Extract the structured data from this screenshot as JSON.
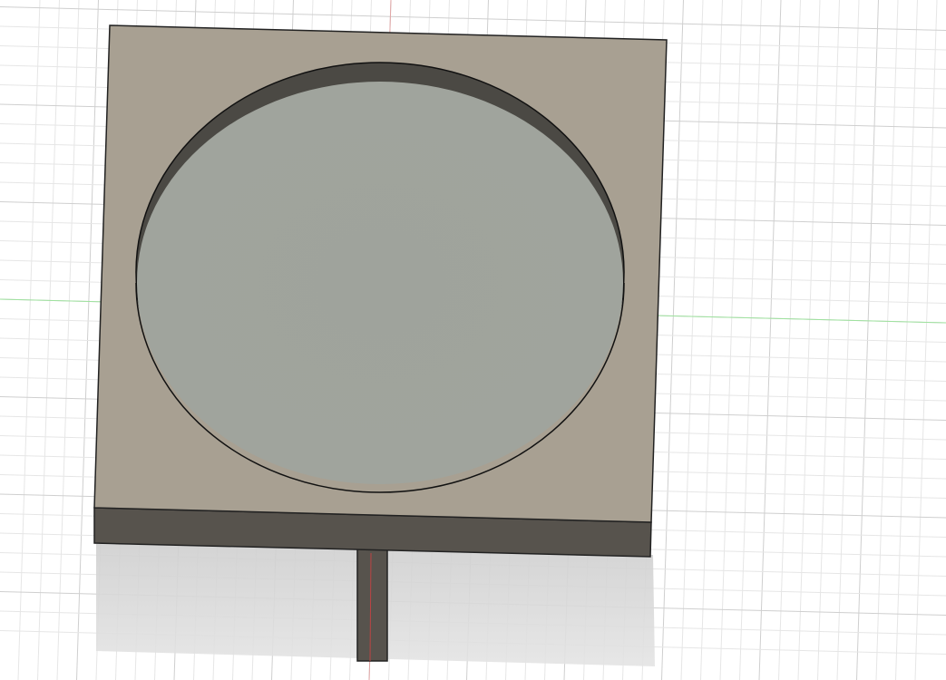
{
  "viewport": {
    "background": "#ffffff",
    "grid_minor_color": "#e6e6e6",
    "grid_major_color": "#cfcfcf",
    "x_axis_color": "#e2a6a6",
    "y_axis_color": "#9ee29e"
  },
  "model": {
    "top_face_color": "#a8a092",
    "side_face_color": "#57534d",
    "pocket_floor_color": "#9ea29c",
    "pocket_wall_color": "#4b4944",
    "stem_color": "#57534d",
    "shadow_color": "#d6d6d6"
  }
}
